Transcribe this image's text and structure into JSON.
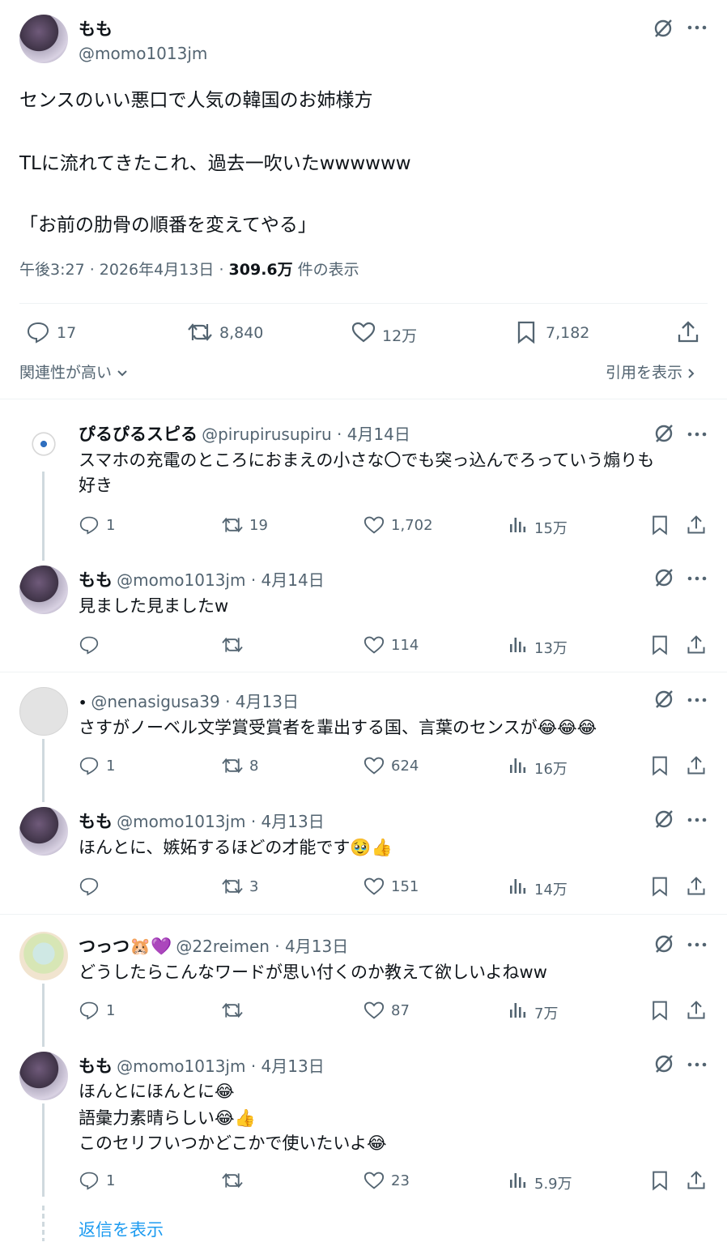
{
  "main_post": {
    "author_name": "もも",
    "handle": "@momo1013jm",
    "lines": [
      "センスのいい悪口で人気の韓国のお姉様方",
      "TLに流れてきたこれ、過去一吹いたwwwwww",
      "「お前の肋骨の順番を変えてやる」"
    ],
    "time": "午後3:27 · 2026年4月13日 · ",
    "views_count": "309.6万",
    "views_label": " 件の表示",
    "replies": "17",
    "reposts": "8,840",
    "likes": "12万",
    "bookmarks": "7,182"
  },
  "filter": {
    "sort_label": "関連性が高い",
    "quotes_label": "引用を表示"
  },
  "replies": [
    {
      "name": "ぴるぴるスピる",
      "handle": "@pirupirusupiru",
      "date": " · 4月14日",
      "lines": [
        "スマホの充電のところにおまえの小さな〇でも突っ込んでろっていう煽りも",
        "好き"
      ],
      "replies": "1",
      "reposts": "19",
      "likes": "1,702",
      "views": "15万"
    },
    {
      "name": "もも",
      "handle": "@momo1013jm",
      "date": " · 4月14日",
      "lines": [
        "見ました見ましたw"
      ],
      "replies": "",
      "reposts": "",
      "likes": "114",
      "views": "13万"
    },
    {
      "name": "•",
      "handle": "@nenasigusa39",
      "date": " · 4月13日",
      "lines": [
        "さすがノーベル文学賞受賞者を輩出する国、言葉のセンスが😂😂😂"
      ],
      "replies": "1",
      "reposts": "8",
      "likes": "624",
      "views": "16万"
    },
    {
      "name": "もも",
      "handle": "@momo1013jm",
      "date": " · 4月13日",
      "lines": [
        "ほんとに、嫉妬するほどの才能です🥹👍"
      ],
      "replies": "",
      "reposts": "3",
      "likes": "151",
      "views": "14万"
    },
    {
      "name": "つっつ🐹💜",
      "handle": "@22reimen",
      "date": " · 4月13日",
      "lines": [
        "どうしたらこんなワードが思い付くのか教えて欲しいよねww"
      ],
      "replies": "1",
      "reposts": "",
      "likes": "87",
      "views": "7万"
    },
    {
      "name": "もも",
      "handle": "@momo1013jm",
      "date": " · 4月13日",
      "lines": [
        "ほんとにほんとに😂",
        "語彙力素晴らしい😂👍",
        "このセリフいつかどこかで使いたいよ😂"
      ],
      "replies": "1",
      "reposts": "",
      "likes": "23",
      "views": "5.9万"
    }
  ],
  "show_replies_label": "返信を表示",
  "colors": {
    "text": "#0f1419",
    "muted": "#536471",
    "link": "#1d9bf0",
    "line": "#cfd9de"
  }
}
